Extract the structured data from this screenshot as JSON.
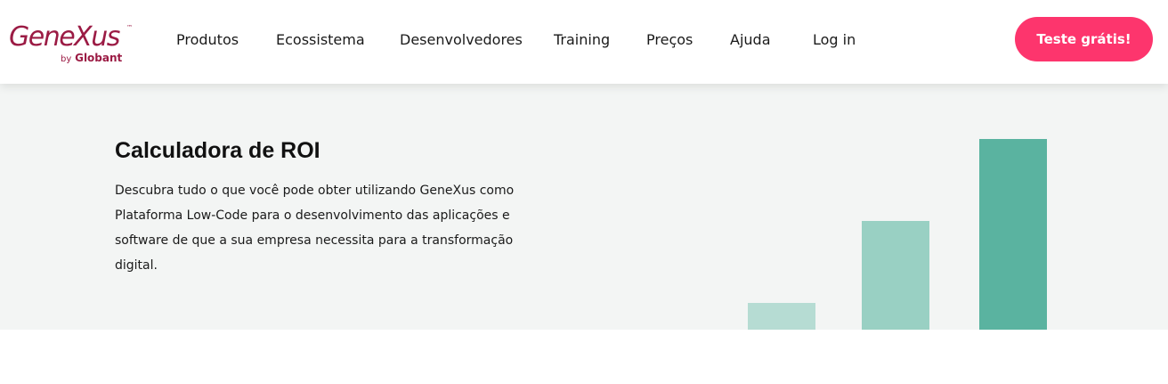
{
  "header": {
    "logo": {
      "name": "GeneXus",
      "trademark": "™",
      "sub_by": "by",
      "sub_brand": "Globant",
      "color": "#9b1b44"
    },
    "nav": [
      {
        "label": "Produtos"
      },
      {
        "label": "Ecossistema"
      },
      {
        "label": "Desenvolvedores"
      },
      {
        "label": "Training"
      },
      {
        "label": "Preços"
      },
      {
        "label": "Ajuda"
      },
      {
        "label": "Log in"
      }
    ],
    "cta": {
      "label": "Teste grátis!",
      "color": "#fd356d"
    }
  },
  "hero": {
    "title": "Calculadora de ROI",
    "description": "Descubra tudo o que você pode obter utilizando GeneXus como Plataforma Low-Code para o desenvolvimento das aplicações e software de que a sua empresa necessita para a transformação digital.",
    "background": "#f3f5f4",
    "illustration_bars": [
      {
        "value": 0.14,
        "color": "#b6dcd3"
      },
      {
        "value": 0.57,
        "color": "#99d0c3"
      },
      {
        "value": 1.0,
        "color": "#5ab3a0"
      }
    ]
  }
}
